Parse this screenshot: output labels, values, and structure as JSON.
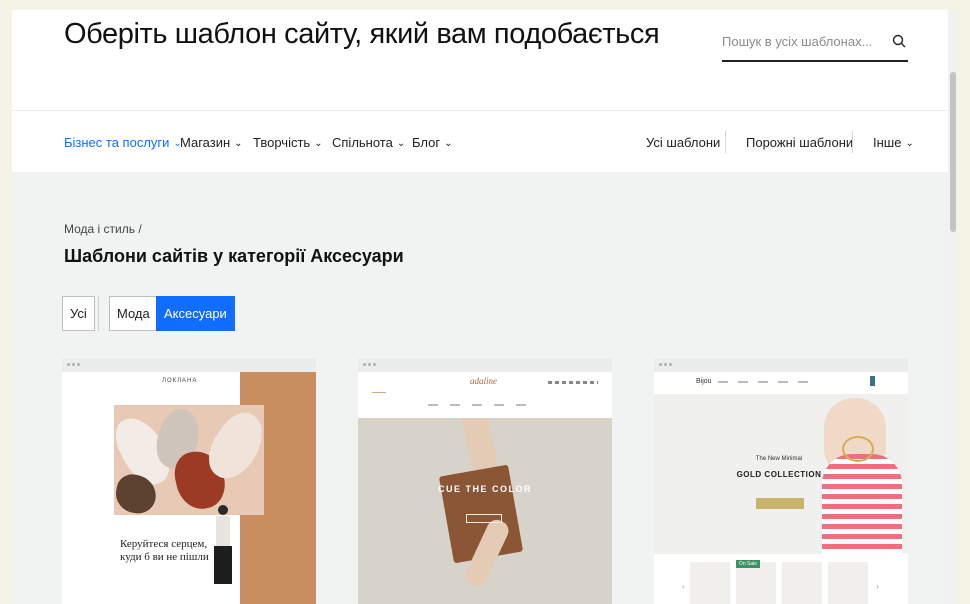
{
  "header": {
    "title": "Оберіть шаблон сайту, який вам подобається",
    "search_placeholder": "Пошук в усіх шаблонах..."
  },
  "nav": {
    "categories": [
      {
        "label": "Бізнес та послуги",
        "active": true
      },
      {
        "label": "Магазин"
      },
      {
        "label": "Творчість"
      },
      {
        "label": "Спільнота"
      },
      {
        "label": "Блог"
      }
    ],
    "right": {
      "all_templates": "Усі шаблони",
      "blank_templates": "Порожні шаблони",
      "other": "Інше"
    }
  },
  "content": {
    "breadcrumb": "Мода і стиль /",
    "section_title": "Шаблони сайтів у категорії Аксесуари",
    "filters": [
      {
        "label": "Усі"
      },
      {
        "label": "Мода"
      },
      {
        "label": "Аксесуари",
        "active": true
      }
    ]
  },
  "cards": [
    {
      "hero_text": "Керуйтеся серцем, куди б ви не пішли",
      "logo": "ЛОКЛАНА"
    },
    {
      "logo": "adaline",
      "hero_text": "CUE THE COLOR"
    },
    {
      "logo": "Bijou",
      "hero_small": "The New Minimal",
      "hero_text": "GOLD COLLECTION",
      "sale_label": "On Sale"
    }
  ],
  "colors": {
    "accent": "#116dff",
    "page_bg": "#f1f2f2"
  }
}
